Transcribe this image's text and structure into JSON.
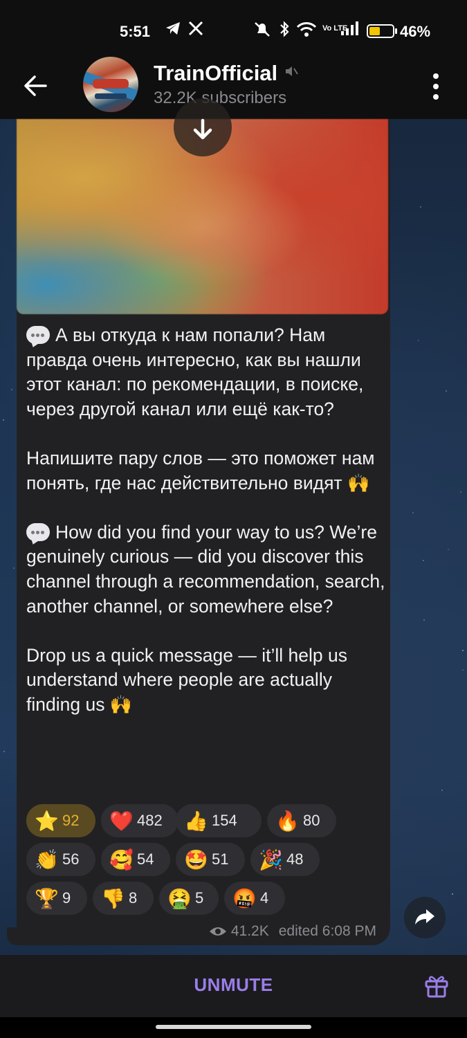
{
  "status_bar": {
    "time": "5:51",
    "battery_percent": "46%",
    "battery_level": 0.46,
    "battery_color": "#f2c500",
    "icons": [
      "telegram-icon",
      "x-icon",
      "mute-icon",
      "bluetooth-icon",
      "wifi-icon",
      "volte-icon",
      "signal-icon",
      "battery-icon"
    ],
    "volte_label": "Vo LTE"
  },
  "header": {
    "channel_name": "TrainOfficial",
    "subscribers": "32.2K subscribers"
  },
  "message": {
    "paragraphs": [
      "А вы откуда к нам попали? Нам правда очень интересно, как вы нашли этот канал: по рекомендации, в поиске, через другой канал или ещё как-то?",
      "Напишите пару слов — это поможет нам понять, где нас действительно видят",
      "How did you find your way to us? We’re genuinely curious — did you discover this channel through a recommendation, search, another channel, or somewhere else?",
      "Drop us a quick message — it’ll help us understand where people are actually finding us"
    ],
    "reactions": [
      {
        "emoji": "⭐",
        "count": "92",
        "name": "star",
        "active": true
      },
      {
        "emoji": "❤️",
        "count": "482",
        "name": "heart"
      },
      {
        "emoji": "👍",
        "count": "154",
        "name": "thumbs-up"
      },
      {
        "emoji": "🔥",
        "count": "80",
        "name": "fire"
      },
      {
        "emoji": "👏",
        "count": "56",
        "name": "clap"
      },
      {
        "emoji": "🥰",
        "count": "54",
        "name": "smiling-hearts"
      },
      {
        "emoji": "🤩",
        "count": "51",
        "name": "star-struck"
      },
      {
        "emoji": "🎉",
        "count": "48",
        "name": "party"
      },
      {
        "emoji": "🏆",
        "count": "9",
        "name": "trophy"
      },
      {
        "emoji": "👎",
        "count": "8",
        "name": "thumbs-down"
      },
      {
        "emoji": "🤮",
        "count": "5",
        "name": "vomit"
      },
      {
        "emoji": "🤬",
        "count": "4",
        "name": "cursing"
      }
    ],
    "views": "41.2K",
    "edited": "edited 6:08 PM"
  },
  "bottom_bar": {
    "unmute_label": "UNMUTE"
  },
  "colors": {
    "accent": "#9b7ee8",
    "bubble": "#212124",
    "star_reaction": "#e4b12e"
  }
}
